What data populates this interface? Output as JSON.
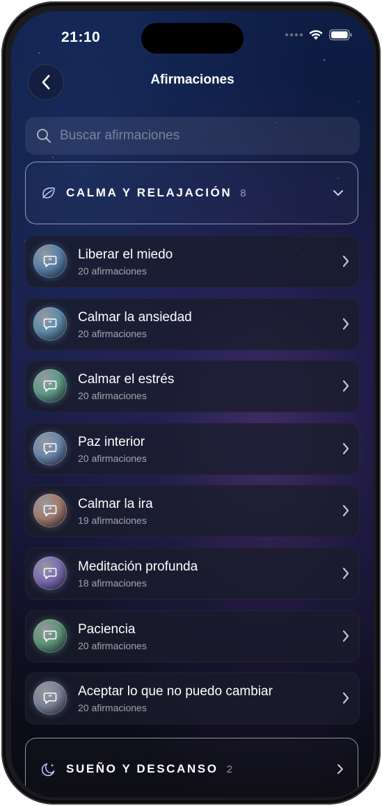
{
  "status_bar": {
    "time": "21:10"
  },
  "header": {
    "title": "Afirmaciones"
  },
  "search": {
    "placeholder": "Buscar afirmaciones"
  },
  "categories": [
    {
      "label": "CALMA Y RELAJACIÓN",
      "count": "8",
      "icon": "leaf-icon",
      "expanded": true
    },
    {
      "label": "SUEÑO Y DESCANSO",
      "count": "2",
      "icon": "moon-icon",
      "expanded": false
    }
  ],
  "items": [
    {
      "title": "Liberar el miedo",
      "subtitle": "20 afirmaciones",
      "orb_color": "#5b7fa6"
    },
    {
      "title": "Calmar la ansiedad",
      "subtitle": "20 afirmaciones",
      "orb_color": "#5f8aa8"
    },
    {
      "title": "Calmar el estrés",
      "subtitle": "20 afirmaciones",
      "orb_color": "#5e9a86"
    },
    {
      "title": "Paz interior",
      "subtitle": "20 afirmaciones",
      "orb_color": "#6a84a8"
    },
    {
      "title": "Calmar la ira",
      "subtitle": "19 afirmaciones",
      "orb_color": "#a07a6e"
    },
    {
      "title": "Meditación profunda",
      "subtitle": "18 afirmaciones",
      "orb_color": "#7a6cb0"
    },
    {
      "title": "Paciencia",
      "subtitle": "20 afirmaciones",
      "orb_color": "#5f9478"
    },
    {
      "title": "Aceptar lo que no puedo cambiar",
      "subtitle": "20 afirmaciones",
      "orb_color": "#7a8296"
    }
  ],
  "colors": {
    "accent": "#b9c4ff",
    "background_top": "#0d1d45",
    "background_bottom": "#0a0a12"
  }
}
